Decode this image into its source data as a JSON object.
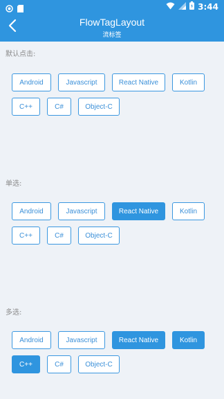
{
  "status_bar": {
    "time": "3:44",
    "left_icons": [
      "circle-notification-icon",
      "sd-card-icon"
    ],
    "right_icons": [
      "wifi-icon",
      "cell-signal-icon",
      "battery-icon"
    ]
  },
  "app_bar": {
    "title": "FlowTagLayout",
    "subtitle": "流标签",
    "back_icon": "back-chevron-icon"
  },
  "colors": {
    "accent": "#2f95df",
    "tag_border": "#3a97e0",
    "tag_text": "#3a8fd8",
    "background": "#eef2f7",
    "label_text": "#8a8a8a"
  },
  "sections": [
    {
      "label": "默认点击:",
      "tags": [
        {
          "text": "Android",
          "selected": false
        },
        {
          "text": "Javascript",
          "selected": false
        },
        {
          "text": "React Native",
          "selected": false
        },
        {
          "text": "Kotlin",
          "selected": false
        },
        {
          "text": "C++",
          "selected": false
        },
        {
          "text": "C#",
          "selected": false
        },
        {
          "text": "Object-C",
          "selected": false
        }
      ]
    },
    {
      "label": "单选:",
      "tags": [
        {
          "text": "Android",
          "selected": false
        },
        {
          "text": "Javascript",
          "selected": false
        },
        {
          "text": "React Native",
          "selected": true
        },
        {
          "text": "Kotlin",
          "selected": false
        },
        {
          "text": "C++",
          "selected": false
        },
        {
          "text": "C#",
          "selected": false
        },
        {
          "text": "Object-C",
          "selected": false
        }
      ]
    },
    {
      "label": "多选:",
      "tags": [
        {
          "text": "Android",
          "selected": false
        },
        {
          "text": "Javascript",
          "selected": false
        },
        {
          "text": "React Native",
          "selected": true
        },
        {
          "text": "Kotlin",
          "selected": true
        },
        {
          "text": "C++",
          "selected": true
        },
        {
          "text": "C#",
          "selected": false
        },
        {
          "text": "Object-C",
          "selected": false
        }
      ]
    }
  ]
}
